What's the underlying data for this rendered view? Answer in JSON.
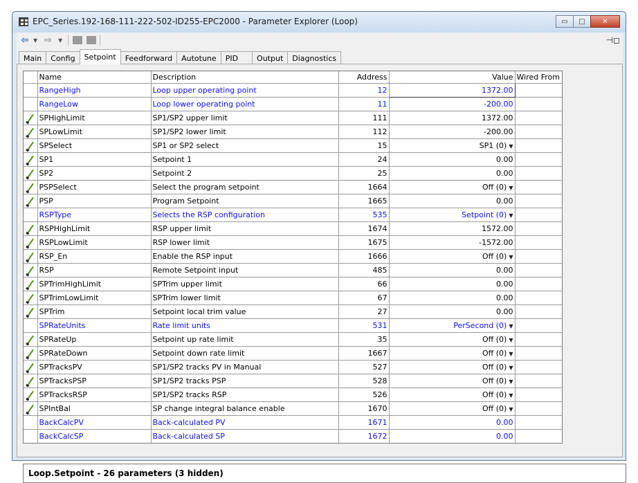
{
  "window": {
    "title": "EPC_Series.192-168-111-222-502-ID255-EPC2000 - Parameter Explorer (Loop)",
    "buttons": {
      "minimize": "▭",
      "maximize": "□",
      "close": "✕"
    }
  },
  "toolbar": {
    "icons": [
      "back-arrow",
      "dropdown",
      "forward-arrow",
      "dropdown",
      "folder",
      "folder-up",
      "pin"
    ]
  },
  "tabs": [
    "Main",
    "Config",
    "Setpoint",
    "Feedforward",
    "Autotune",
    "PID",
    "Output",
    "Diagnostics"
  ],
  "active_tab": "Setpoint",
  "table": {
    "columns": [
      "Name",
      "Description",
      "Address",
      "Value",
      "Wired From"
    ],
    "rows": [
      {
        "name": "RangeHigh",
        "description": "Loop upper operating point",
        "address": "12",
        "value": "1372.00",
        "wired": "",
        "editable": false,
        "dropdown": false,
        "blue": true
      },
      {
        "name": "RangeLow",
        "description": "Loop lower operating point",
        "address": "11",
        "value": "-200.00",
        "wired": "",
        "editable": false,
        "dropdown": false,
        "blue": true
      },
      {
        "name": "SPHighLimit",
        "description": "SP1/SP2 upper limit",
        "address": "111",
        "value": "1372.00",
        "wired": "",
        "editable": true,
        "dropdown": false,
        "blue": false
      },
      {
        "name": "SPLowLimit",
        "description": "SP1/SP2 lower limit",
        "address": "112",
        "value": "-200.00",
        "wired": "",
        "editable": true,
        "dropdown": false,
        "blue": false
      },
      {
        "name": "SPSelect",
        "description": "SP1 or SP2 select",
        "address": "15",
        "value": "SP1 (0)",
        "wired": "",
        "editable": true,
        "dropdown": true,
        "blue": false
      },
      {
        "name": "SP1",
        "description": "Setpoint 1",
        "address": "24",
        "value": "0.00",
        "wired": "",
        "editable": true,
        "dropdown": false,
        "blue": false
      },
      {
        "name": "SP2",
        "description": "Setpoint 2",
        "address": "25",
        "value": "0.00",
        "wired": "",
        "editable": true,
        "dropdown": false,
        "blue": false
      },
      {
        "name": "PSPSelect",
        "description": "Select the program setpoint",
        "address": "1664",
        "value": "Off (0)",
        "wired": "",
        "editable": true,
        "dropdown": true,
        "blue": false
      },
      {
        "name": "PSP",
        "description": "Program Setpoint",
        "address": "1665",
        "value": "0.00",
        "wired": "",
        "editable": true,
        "dropdown": false,
        "blue": false
      },
      {
        "name": "RSPType",
        "description": "Selects the RSP configuration",
        "address": "535",
        "value": "Setpoint (0)",
        "wired": "",
        "editable": false,
        "dropdown": true,
        "blue": true
      },
      {
        "name": "RSPHighLimit",
        "description": "RSP upper limit",
        "address": "1674",
        "value": "1572.00",
        "wired": "",
        "editable": true,
        "dropdown": false,
        "blue": false
      },
      {
        "name": "RSPLowLimit",
        "description": "RSP lower limit",
        "address": "1675",
        "value": "-1572.00",
        "wired": "",
        "editable": true,
        "dropdown": false,
        "blue": false
      },
      {
        "name": "RSP_En",
        "description": "Enable the RSP input",
        "address": "1666",
        "value": "Off (0)",
        "wired": "",
        "editable": true,
        "dropdown": true,
        "blue": false
      },
      {
        "name": "RSP",
        "description": "Remote Setpoint input",
        "address": "485",
        "value": "0.00",
        "wired": "",
        "editable": true,
        "dropdown": false,
        "blue": false
      },
      {
        "name": "SPTrimHighLimit",
        "description": "SPTrim upper limit",
        "address": "66",
        "value": "0.00",
        "wired": "",
        "editable": true,
        "dropdown": false,
        "blue": false
      },
      {
        "name": "SPTrimLowLimit",
        "description": "SPTrim lower limit",
        "address": "67",
        "value": "0.00",
        "wired": "",
        "editable": true,
        "dropdown": false,
        "blue": false
      },
      {
        "name": "SPTrim",
        "description": "Setpoint local trim value",
        "address": "27",
        "value": "0.00",
        "wired": "",
        "editable": true,
        "dropdown": false,
        "blue": false
      },
      {
        "name": "SPRateUnits",
        "description": "Rate limit units",
        "address": "531",
        "value": "PerSecond (0)",
        "wired": "",
        "editable": false,
        "dropdown": true,
        "blue": true
      },
      {
        "name": "SPRateUp",
        "description": "Setpoint up rate limit",
        "address": "35",
        "value": "Off (0)",
        "wired": "",
        "editable": true,
        "dropdown": true,
        "blue": false
      },
      {
        "name": "SPRateDown",
        "description": "Setpoint down rate limit",
        "address": "1667",
        "value": "Off (0)",
        "wired": "",
        "editable": true,
        "dropdown": true,
        "blue": false
      },
      {
        "name": "SPTracksPV",
        "description": "SP1/SP2 tracks PV in Manual",
        "address": "527",
        "value": "Off (0)",
        "wired": "",
        "editable": true,
        "dropdown": true,
        "blue": false
      },
      {
        "name": "SPTracksPSP",
        "description": "SP1/SP2 tracks PSP",
        "address": "528",
        "value": "Off (0)",
        "wired": "",
        "editable": true,
        "dropdown": true,
        "blue": false
      },
      {
        "name": "SPTracksRSP",
        "description": "SP1/SP2 tracks RSP",
        "address": "526",
        "value": "Off (0)",
        "wired": "",
        "editable": true,
        "dropdown": true,
        "blue": false
      },
      {
        "name": "SPIntBal",
        "description": "SP change integral balance enable",
        "address": "1670",
        "value": "Off (0)",
        "wired": "",
        "editable": true,
        "dropdown": true,
        "blue": false
      },
      {
        "name": "BackCalcPV",
        "description": "Back-calculated PV",
        "address": "1671",
        "value": "0.00",
        "wired": "",
        "editable": false,
        "dropdown": false,
        "blue": true
      },
      {
        "name": "BackCalcSP",
        "description": "Back-calculated SP",
        "address": "1672",
        "value": "0.00",
        "wired": "",
        "editable": false,
        "dropdown": false,
        "blue": true
      }
    ]
  },
  "status": {
    "text": "Loop.Setpoint  -  26 parameters (3 hidden)"
  },
  "colors": {
    "readonly_text": "#1010e0",
    "pencil": "#5a8a18",
    "title_bg": "#dde9f5"
  }
}
